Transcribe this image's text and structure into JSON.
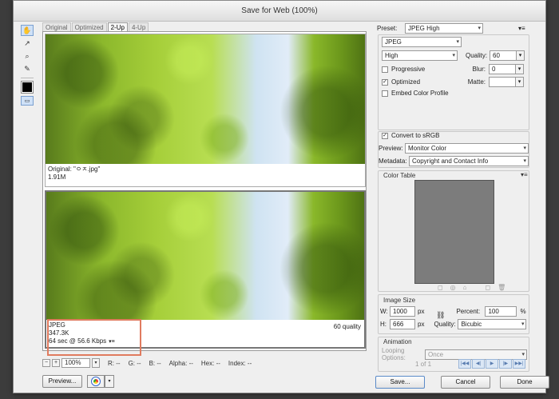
{
  "window": {
    "title": "Save for Web (100%)"
  },
  "tabs": [
    "Original",
    "Optimized",
    "2-Up",
    "4-Up"
  ],
  "tools": [
    "hand-tool-icon",
    "slice-select-icon",
    "zoom-icon",
    "eyedropper-icon"
  ],
  "original_pane": {
    "filename": "Original: \"ㅇㅈ.jpg\"",
    "size": "1.91M"
  },
  "optimized_pane": {
    "format": "JPEG",
    "size": "347.3K",
    "time": "64 sec @ 56.6 Kbps",
    "quality": "60 quality"
  },
  "status": {
    "zoom": "100%",
    "r": "R: --",
    "g": "G: --",
    "b": "B: --",
    "alpha": "Alpha: --",
    "hex": "Hex: --",
    "index": "Index: --"
  },
  "buttons": {
    "preview": "Preview...",
    "save": "Save...",
    "cancel": "Cancel",
    "done": "Done"
  },
  "settings": {
    "preset_label": "Preset:",
    "preset_value": "JPEG High",
    "format": "JPEG",
    "compression": "High",
    "quality_label": "Quality:",
    "quality_value": "60",
    "blur_label": "Blur:",
    "blur_value": "0",
    "matte_label": "Matte:",
    "progressive_label": "Progressive",
    "optimized_label": "Optimized",
    "embed_label": "Embed Color Profile",
    "convert_label": "Convert to sRGB",
    "preview_label": "Preview:",
    "preview_value": "Monitor Color",
    "metadata_label": "Metadata:",
    "metadata_value": "Copyright and Contact Info",
    "progressive_checked": false,
    "optimized_checked": true,
    "embed_checked": false,
    "convert_checked": true
  },
  "color_table": {
    "title": "Color Table"
  },
  "image_size": {
    "title": "Image Size",
    "w_label": "W:",
    "w_value": "1000",
    "h_label": "H:",
    "h_value": "666",
    "unit": "px",
    "percent_label": "Percent:",
    "percent_value": "100",
    "percent_unit": "%",
    "quality_label": "Quality:",
    "quality_value": "Bicubic"
  },
  "animation": {
    "title": "Animation",
    "looping_label": "Looping Options:",
    "looping_value": "Once",
    "frame": "1 of 1"
  },
  "colors": {
    "highlight": "#e07b5f",
    "selected_tool": "#cfe1f7",
    "color_table_bg": "#7c7c7c"
  }
}
